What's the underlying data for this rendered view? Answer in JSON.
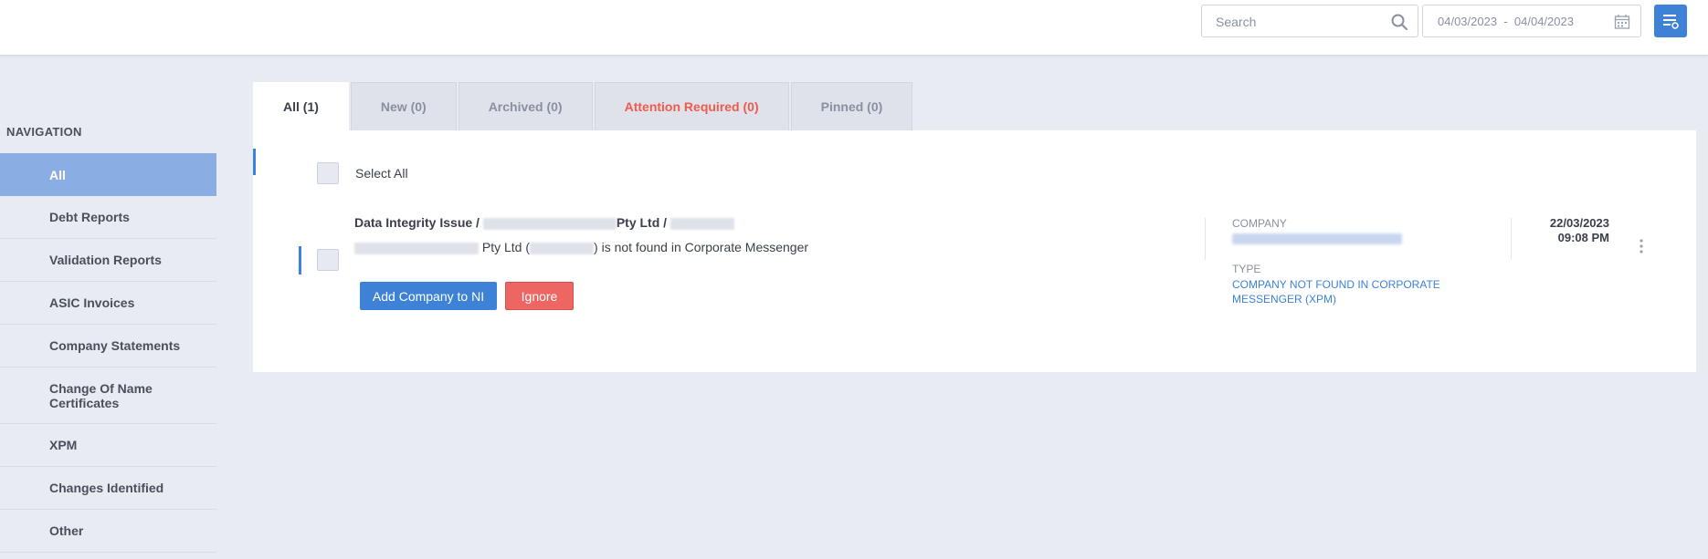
{
  "header": {
    "search_placeholder": "Search",
    "date_from": "04/03/2023",
    "date_sep": "-",
    "date_to": "04/04/2023"
  },
  "sidebar": {
    "title": "NAVIGATION",
    "items": [
      {
        "label": "All",
        "active": true
      },
      {
        "label": "Debt Reports"
      },
      {
        "label": "Validation Reports"
      },
      {
        "label": "ASIC Invoices"
      },
      {
        "label": "Company Statements"
      },
      {
        "label": "Change Of Name Certificates"
      },
      {
        "label": "XPM"
      },
      {
        "label": "Changes Identified"
      },
      {
        "label": "Other"
      }
    ]
  },
  "tabs": [
    {
      "label": "All (1)",
      "active": true
    },
    {
      "label": "New (0)"
    },
    {
      "label": "Archived (0)"
    },
    {
      "label": "Attention Required (0)",
      "alert_color": "#ee5a4e"
    },
    {
      "label": "Pinned (0)"
    }
  ],
  "list": {
    "select_all_label": "Select All",
    "rows": [
      {
        "title_prefix": "Data Integrity Issue /",
        "title_mid": "Pty Ltd /",
        "desc_pre": "Pty Ltd (",
        "desc_post": ") is not found in Corporate Messenger",
        "add_button": "Add Company to NI",
        "ignore_button": "Ignore",
        "company_label": "COMPANY",
        "type_label": "TYPE",
        "type_value": "COMPANY NOT FOUND IN CORPORATE MESSENGER (XPM)",
        "date": "22/03/2023",
        "time": "09:08 PM"
      }
    ]
  },
  "colors": {
    "accent": "#3d82d6",
    "nav_active": "#8aaee4",
    "danger": "#ee6663"
  }
}
